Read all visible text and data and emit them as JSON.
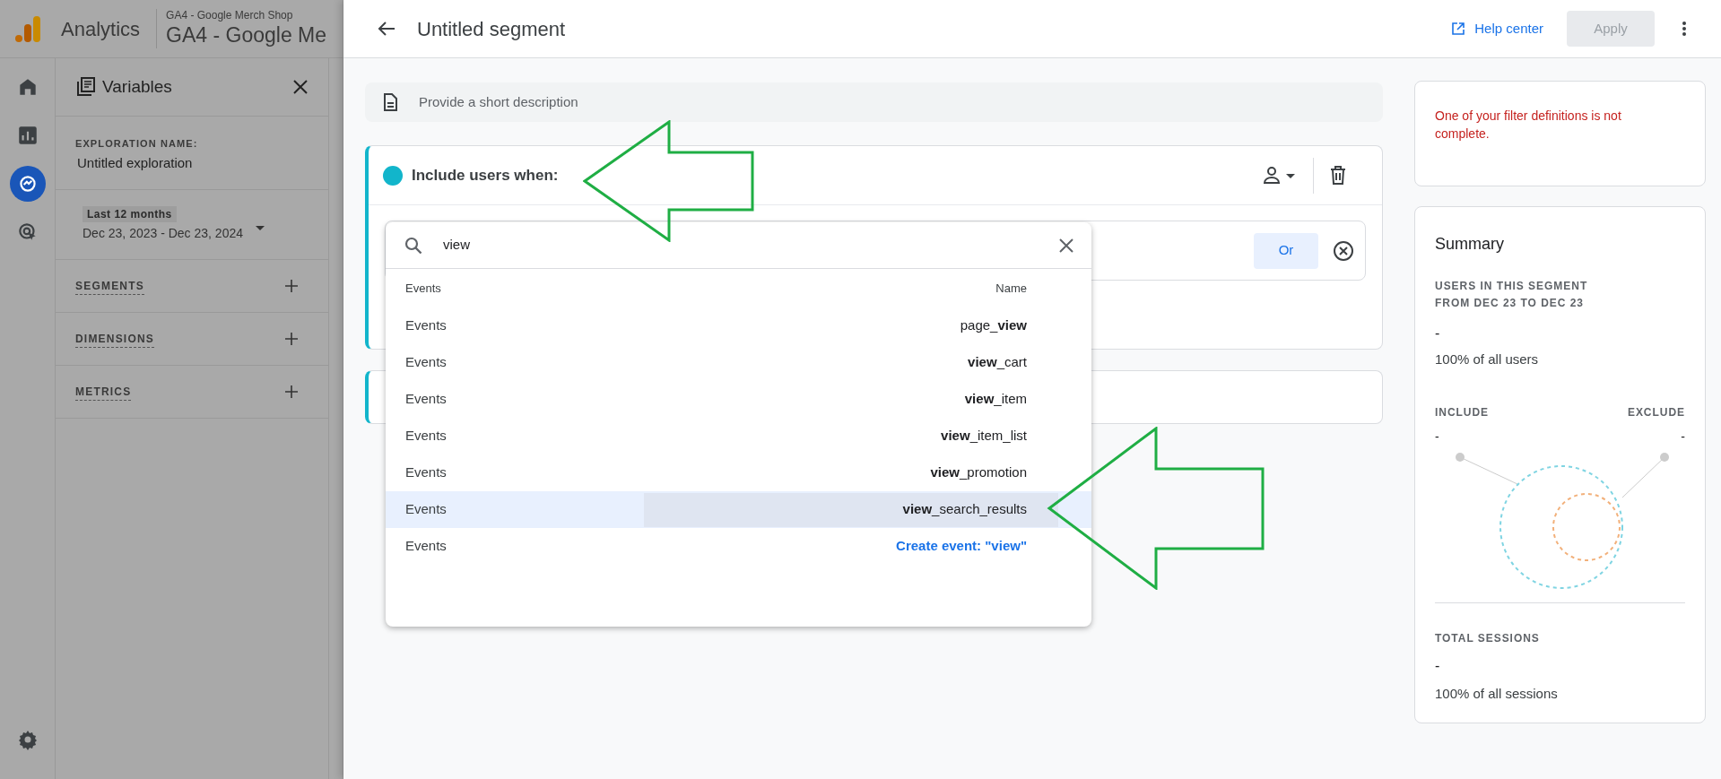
{
  "app_bar": {
    "product": "Analytics",
    "account": "GA4 - Google Merch Shop",
    "property": "GA4 - Google Me"
  },
  "nav_rail": [
    {
      "kind": "home",
      "selected": false
    },
    {
      "kind": "reports",
      "selected": false
    },
    {
      "kind": "explore",
      "selected": true
    },
    {
      "kind": "advertising",
      "selected": false
    }
  ],
  "variables_panel": {
    "title": "Variables",
    "exploration_name_label": "EXPLORATION NAME:",
    "exploration_name": "Untitled exploration",
    "date_preset": "Last 12 months",
    "date_range": "Dec 23, 2023 - Dec 23, 2024",
    "sections": [
      "SEGMENTS",
      "DIMENSIONS",
      "METRICS"
    ]
  },
  "segment_editor": {
    "title": "Untitled segment",
    "help_link": "Help center",
    "apply_button": {
      "label": "Apply",
      "disabled": true
    },
    "description_placeholder": "Provide a short description",
    "condition_group": {
      "label": "Include users when:",
      "color": "#12b5cb"
    },
    "or_button": "Or",
    "search": {
      "value": "view"
    },
    "dropdown": {
      "columns": [
        "Events",
        "Name"
      ],
      "rows": [
        {
          "kind": "event",
          "category": "Events",
          "name": "page_**view**",
          "selected": false
        },
        {
          "kind": "event",
          "category": "Events",
          "name": "**view**_cart",
          "selected": false
        },
        {
          "kind": "event",
          "category": "Events",
          "name": "**view**_item",
          "selected": false
        },
        {
          "kind": "event",
          "category": "Events",
          "name": "**view**_item_list",
          "selected": false
        },
        {
          "kind": "event",
          "category": "Events",
          "name": "**view**_promotion",
          "selected": false
        },
        {
          "kind": "event",
          "category": "Events",
          "name": "**view**_search_results",
          "selected": true
        },
        {
          "kind": "create",
          "category": "Events",
          "name": "Create event: \"view\"",
          "selected": false
        }
      ]
    }
  },
  "summary": {
    "error_message": "One of your filter definitions is not complete.",
    "title": "Summary",
    "users_label": [
      "USERS IN THIS SEGMENT",
      "FROM DEC 23 TO DEC 23"
    ],
    "users_value": "-",
    "users_share": "100% of all users",
    "include_label": "INCLUDE",
    "include_value": "-",
    "exclude_label": "EXCLUDE",
    "exclude_value": "-",
    "sessions_label": "TOTAL SESSIONS",
    "sessions_value": "-",
    "sessions_share": "100% of all sessions"
  }
}
